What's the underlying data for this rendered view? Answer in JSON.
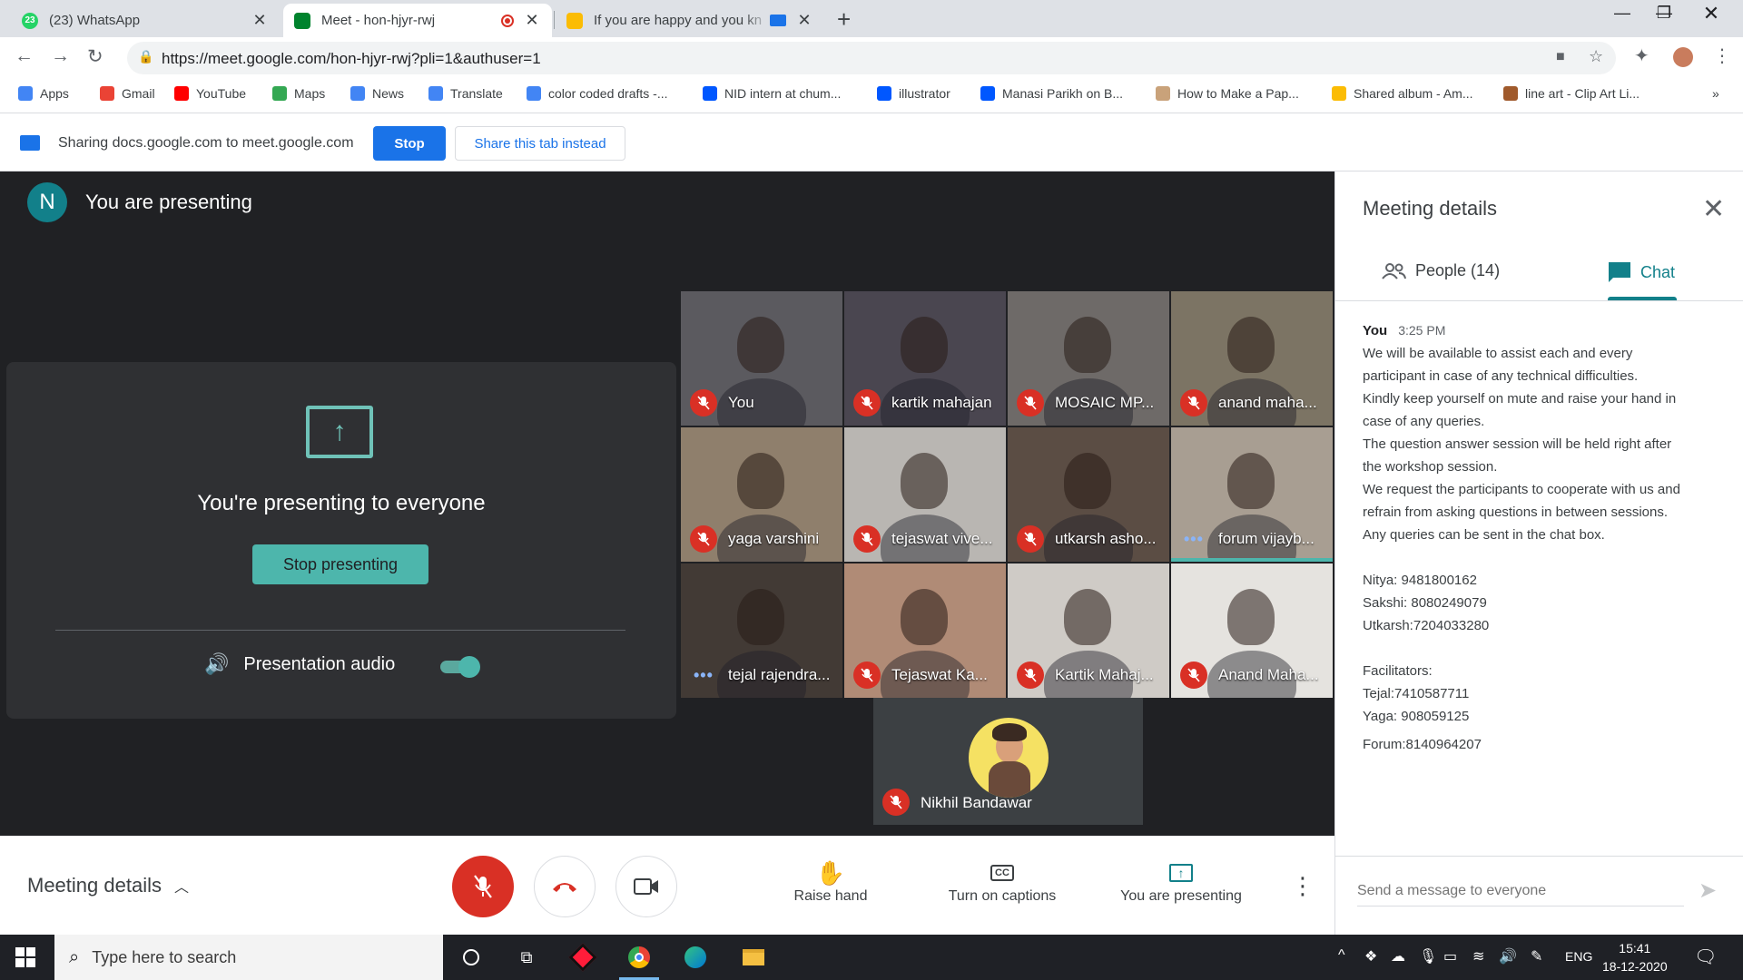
{
  "browser": {
    "tabs": [
      {
        "title": "(23) WhatsApp",
        "badge": "23"
      },
      {
        "title": "Meet - hon-hjyr-rwj"
      },
      {
        "title": "If you are happy and you kn"
      }
    ],
    "url": "https://meet.google.com/hon-hjyr-rwj?pli=1&authuser=1",
    "bookmarks": [
      {
        "label": "Apps",
        "color": "#4285f4"
      },
      {
        "label": "Gmail",
        "color": "#ea4335"
      },
      {
        "label": "YouTube",
        "color": "#ff0000"
      },
      {
        "label": "Maps",
        "color": "#34a853"
      },
      {
        "label": "News",
        "color": "#4285f4"
      },
      {
        "label": "Translate",
        "color": "#4285f4"
      },
      {
        "label": "color coded drafts -...",
        "color": "#4285f4"
      },
      {
        "label": "NID intern at chum...",
        "color": "#0057ff"
      },
      {
        "label": "illustrator",
        "color": "#0057ff"
      },
      {
        "label": "Manasi Parikh on B...",
        "color": "#0057ff"
      },
      {
        "label": "How to Make a Pap...",
        "color": "#c9a27a"
      },
      {
        "label": "Shared album - Am...",
        "color": "#fbbc04"
      },
      {
        "label": "line art - Clip Art Li...",
        "color": "#a05a2c"
      }
    ],
    "overflow": "»"
  },
  "sharebar": {
    "text": "Sharing docs.google.com to meet.google.com",
    "stop_label": "Stop",
    "share_tab_label": "Share this tab instead"
  },
  "meet": {
    "avatar_letter": "N",
    "presenting_title": "You are presenting",
    "card": {
      "message": "You're presenting to everyone",
      "stop_label": "Stop presenting",
      "audio_label": "Presentation audio",
      "audio_on": true
    },
    "participants": [
      {
        "name": "You",
        "status": "muted",
        "bg": "#5b5a5f"
      },
      {
        "name": "kartik mahajan",
        "status": "muted",
        "bg": "#4a4650"
      },
      {
        "name": "MOSAIC MP...",
        "status": "muted",
        "bg": "#6e6a68"
      },
      {
        "name": "anand maha...",
        "status": "muted",
        "bg": "#7c7464"
      },
      {
        "name": "yaga varshini",
        "status": "muted",
        "bg": "#8f7f6c"
      },
      {
        "name": "tejaswat vive...",
        "status": "muted",
        "bg": "#b9b6b2"
      },
      {
        "name": "utkarsh asho...",
        "status": "muted",
        "bg": "#5b4d44"
      },
      {
        "name": "forum vijayb...",
        "status": "speaking",
        "bg": "#a89e92"
      },
      {
        "name": "tejal rajendra...",
        "status": "speaking",
        "bg": "#423a35"
      },
      {
        "name": "Tejaswat Ka...",
        "status": "muted",
        "bg": "#b08b76"
      },
      {
        "name": "Kartik Mahaj...",
        "status": "muted",
        "bg": "#cfcbc6"
      },
      {
        "name": "Anand Maha...",
        "status": "muted",
        "bg": "#e5e3df"
      }
    ],
    "featured": {
      "name": "Nikhil Bandawar"
    }
  },
  "controls": {
    "meeting_details": "Meeting details",
    "raise_hand": "Raise hand",
    "captions": "Turn on captions",
    "presenting": "You are presenting"
  },
  "panel": {
    "title": "Meeting details",
    "people_tab": "People (14)",
    "chat_tab": "Chat",
    "message": {
      "sender": "You",
      "time": "3:25 PM",
      "lines": [
        " We will be available to assist each and every",
        "participant in case of any technical difficulties.",
        "Kindly keep yourself on mute and raise your hand in",
        "case of any queries.",
        "The question answer session will be held right after",
        "the workshop session.",
        "We request the participants to cooperate with us and",
        "refrain from asking questions in between sessions.",
        "Any queries can be sent in the chat box.",
        "",
        "Nitya: 9481800162",
        "Sakshi: 8080249079",
        "Utkarsh:7204033280",
        "",
        "Facilitators:",
        "Tejal:7410587711",
        "Yaga: 908059125"
      ],
      "last_line": "Forum:8140964207"
    },
    "input_placeholder": "Send a message to everyone"
  },
  "taskbar": {
    "search_placeholder": "Type here to search",
    "language": "ENG",
    "time": "15:41",
    "date": "18-12-2020"
  }
}
